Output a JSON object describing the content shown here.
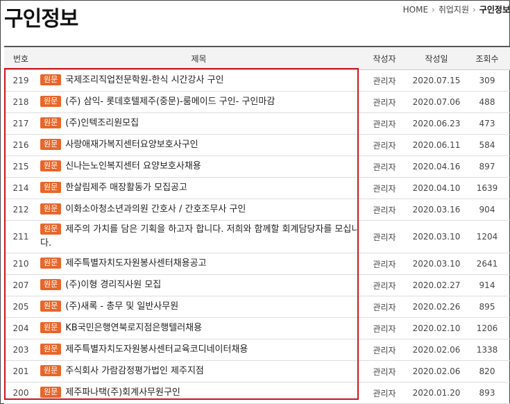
{
  "page": {
    "title": "구인정보"
  },
  "breadcrumb": {
    "home": "HOME",
    "section": "취업지원",
    "current": "구인정보"
  },
  "table": {
    "headers": {
      "no": "번호",
      "subject": "제목",
      "author": "작성자",
      "date": "작성일",
      "views": "조회수"
    },
    "badge_label": "원문",
    "rows": [
      {
        "no": "219",
        "subject": "국제조리직업전문학원-한식 시간강사 구인",
        "author": "관리자",
        "date": "2020.07.15",
        "views": "309"
      },
      {
        "no": "218",
        "subject": "(주) 삼익- 롯데호텔제주(중문)-룸메이드 구인- 구인마감",
        "author": "관리자",
        "date": "2020.07.06",
        "views": "488"
      },
      {
        "no": "217",
        "subject": "(주)인텍조리원모집",
        "author": "관리자",
        "date": "2020.06.23",
        "views": "473"
      },
      {
        "no": "216",
        "subject": "사랑애재가복지센터요양보호사구인",
        "author": "관리자",
        "date": "2020.06.11",
        "views": "584"
      },
      {
        "no": "215",
        "subject": "신나는노인복지센터 요양보호사채용",
        "author": "관리자",
        "date": "2020.04.16",
        "views": "897"
      },
      {
        "no": "214",
        "subject": "한살림제주 매장활동가 모집공고",
        "author": "관리자",
        "date": "2020.04.10",
        "views": "1639"
      },
      {
        "no": "212",
        "subject": "이화소아청소년과의원 간호사 / 간호조무사 구인",
        "author": "관리자",
        "date": "2020.03.16",
        "views": "904"
      },
      {
        "no": "211",
        "subject": "제주의 가치를 담은 기획을 하고자 합니다. 저희와 함께할 회계담당자를 모십니다.",
        "author": "관리자",
        "date": "2020.03.10",
        "views": "1204"
      },
      {
        "no": "210",
        "subject": "제주특별자치도자원봉사센터채용공고",
        "author": "관리자",
        "date": "2020.03.10",
        "views": "2641"
      },
      {
        "no": "207",
        "subject": "(주)이형 경리직사원 모집",
        "author": "관리자",
        "date": "2020.02.27",
        "views": "914"
      },
      {
        "no": "205",
        "subject": "(주)새록 - 총무 및 일반사무원",
        "author": "관리자",
        "date": "2020.02.26",
        "views": "895"
      },
      {
        "no": "204",
        "subject": "KB국민은행연북로지점은행텔러채용",
        "author": "관리자",
        "date": "2020.02.10",
        "views": "1206"
      },
      {
        "no": "203",
        "subject": "제주특별자치도자원봉사센터교육코디네이터채용",
        "author": "관리자",
        "date": "2020.02.06",
        "views": "1338"
      },
      {
        "no": "201",
        "subject": "주식회사 가람감정평가법인 제주지점",
        "author": "관리자",
        "date": "2020.02.06",
        "views": "820"
      },
      {
        "no": "200",
        "subject": "제주파나택(주)회계사무원구인",
        "author": "관리자",
        "date": "2020.01.20",
        "views": "893"
      }
    ]
  }
}
